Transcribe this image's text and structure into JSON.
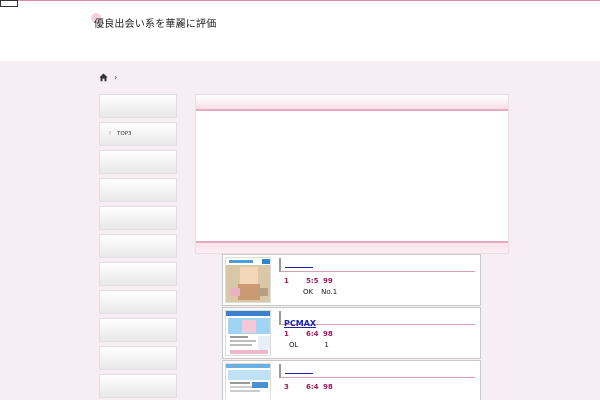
{
  "site": {
    "title": "優良出会い系を華麗に評価"
  },
  "breadcrumb": {
    "separator": "›"
  },
  "sidebar": {
    "items": [
      {
        "label": ""
      },
      {
        "bullet": "!",
        "label": "TOP3"
      },
      {
        "label": ""
      },
      {
        "label": ""
      },
      {
        "label": ""
      },
      {
        "label": ""
      },
      {
        "label": ""
      },
      {
        "label": ""
      },
      {
        "label": ""
      },
      {
        "label": ""
      },
      {
        "label": ""
      }
    ]
  },
  "entries": [
    {
      "name": "",
      "rank": "1",
      "score": "5:5",
      "value": "99",
      "tag1": "OK",
      "tag2": "No.1"
    },
    {
      "name": "PCMAX",
      "rank": "1",
      "score": "6:4",
      "value": "98",
      "tag1": "OL",
      "tag2": "1"
    },
    {
      "name": "",
      "rank": "3",
      "score": "6:4",
      "value": "98",
      "tag1": "",
      "tag2": ""
    }
  ],
  "colors": {
    "accent": "#e9a9bd",
    "link": "#1a23a8",
    "stat": "#a0195b",
    "page_bg": "#f7eef3"
  }
}
